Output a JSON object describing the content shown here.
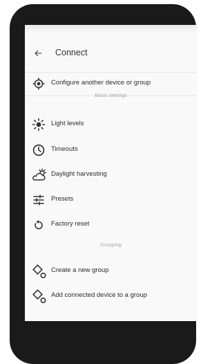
{
  "header": {
    "title": "Connect"
  },
  "top_item": {
    "label": "Configure another device or group"
  },
  "sections": {
    "basic": "Basic settings",
    "grouping": "Grouping"
  },
  "basic_items": [
    {
      "label": "Light levels",
      "icon": "light-levels-icon"
    },
    {
      "label": "Timeouts",
      "icon": "timer-icon"
    },
    {
      "label": "Daylight harvesting",
      "icon": "daylight-icon"
    },
    {
      "label": "Presets",
      "icon": "sliders-icon"
    },
    {
      "label": "Factory reset",
      "icon": "reset-icon"
    }
  ],
  "grouping_items": [
    {
      "label": "Create a new group",
      "icon": "create-group-icon"
    },
    {
      "label": "Add connected device to a group",
      "icon": "add-to-group-icon"
    }
  ],
  "colors": {
    "frame": "#1a1a1a",
    "screen": "#f9f9f9",
    "text": "#2b2b2b",
    "section": "#a8a8a8"
  }
}
